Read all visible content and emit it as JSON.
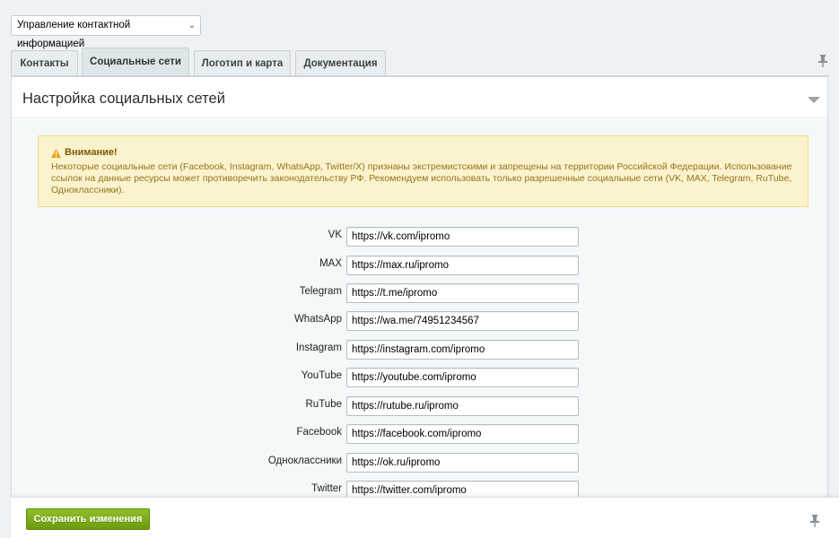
{
  "top_select": {
    "value": "Управление контактной информацией"
  },
  "tabs": [
    {
      "label": "Контакты",
      "active": false
    },
    {
      "label": "Социальные сети",
      "active": true
    },
    {
      "label": "Логотип и карта",
      "active": false
    },
    {
      "label": "Документация",
      "active": false
    }
  ],
  "panel": {
    "title": "Настройка социальных сетей",
    "alert": {
      "title": "Внимание!",
      "text": "Некоторые социальные сети (Facebook, Instagram, WhatsApp, Twitter/X) признаны экстремистскими и запрещены на территории Российской Федерации. Использование ссылок на данные ресурсы может противоречить законодательству РФ. Рекомендуем использовать только разрешенные социальные сети (VK, MAX, Telegram, RuTube, Одноклассники)."
    },
    "fields": [
      {
        "label": "VK",
        "value": "https://vk.com/ipromo"
      },
      {
        "label": "MAX",
        "value": "https://max.ru/ipromo"
      },
      {
        "label": "Telegram",
        "value": "https://t.me/ipromo"
      },
      {
        "label": "WhatsApp",
        "value": "https://wa.me/74951234567"
      },
      {
        "label": "Instagram",
        "value": "https://instagram.com/ipromo"
      },
      {
        "label": "YouTube",
        "value": "https://youtube.com/ipromo"
      },
      {
        "label": "RuTube",
        "value": "https://rutube.ru/ipromo"
      },
      {
        "label": "Facebook",
        "value": "https://facebook.com/ipromo"
      },
      {
        "label": "Одноклассники",
        "value": "https://ok.ru/ipromo"
      },
      {
        "label": "Twitter",
        "value": "https://twitter.com/ipromo"
      }
    ]
  },
  "footer": {
    "save_label": "Сохранить изменения"
  },
  "colors": {
    "save_button": "#7aa81a",
    "alert_background": "#fbf3cd",
    "alert_border": "#f1dc8e"
  },
  "icons": [
    "chevron-down-icon",
    "pin-icon",
    "collapse-triangle-icon",
    "warning-icon"
  ]
}
